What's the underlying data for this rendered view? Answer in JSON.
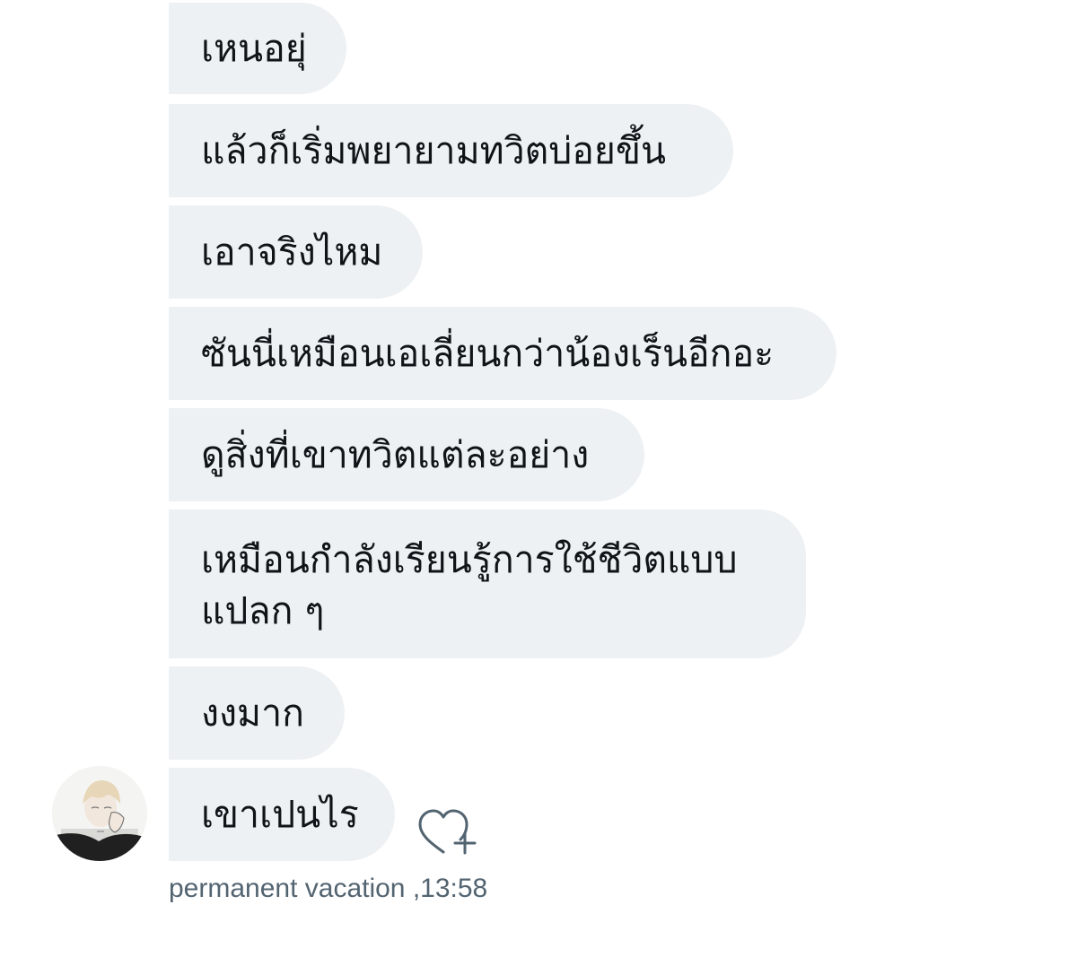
{
  "messages": [
    {
      "text": "เหนอยุ่"
    },
    {
      "text": "แล้วก็เริ่มพยายามทวิตบ่อยขึ้น"
    },
    {
      "text": "เอาจริงไหม"
    },
    {
      "text": "ซันนี่เหมือนเอเลี่ยนกว่าน้องเร็นอีกอะ"
    },
    {
      "text": "ดูสิ่งที่เขาทวิตแต่ละอย่าง"
    },
    {
      "text": "เหมือนกำลังเรียนรู้การใช้ชีวิตแบบแปลก ๆ"
    },
    {
      "text": "งงมาก"
    },
    {
      "text": "เขาเปนไร"
    }
  ],
  "meta": {
    "sender": "permanent vacation",
    "separator": " ,",
    "time": "13:58"
  },
  "icons": {
    "avatar": "avatar-image",
    "reaction": "heart-plus-icon"
  },
  "colors": {
    "bubble_bg": "#eef1f3",
    "text": "#0f1419",
    "meta_text": "#536471"
  }
}
